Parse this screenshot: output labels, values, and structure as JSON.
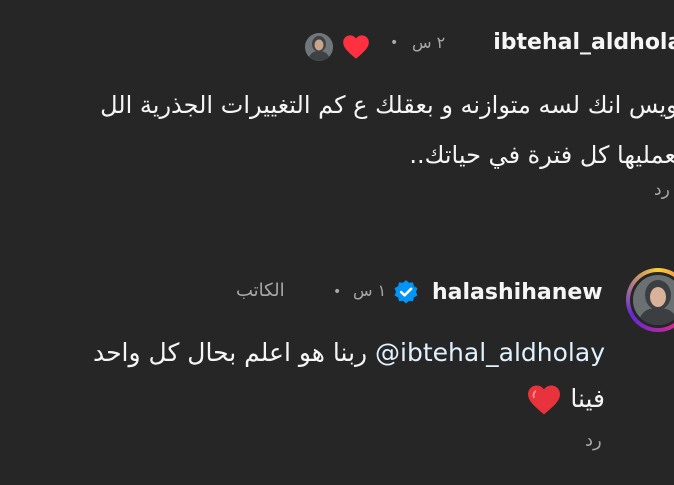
{
  "comment1": {
    "username": "ibtehal_aldholay",
    "time": "٢ س",
    "separator": "•",
    "reaction_icon": "heart-icon",
    "line1": "كويس انك لسه متوازنه و بعقلك ع كم التغييرات الجذرية الل",
    "line2": "بتعمليها كل فترة في حياتك..",
    "reply_label": "رد"
  },
  "comment2": {
    "username": "halashihanew",
    "verified_icon": "verified-badge-icon",
    "time": "١ س",
    "separator": "•",
    "author_label": "الكاتب",
    "mention": "@ibtehal_aldholay",
    "text_after_mention": "ربنا هو اعلم بحال كل واحد",
    "line2": "فينا",
    "emoji_icon": "red-heart-icon",
    "reply_label": "رد"
  },
  "colors": {
    "background": "#262626",
    "text": "#f5f5f5",
    "secondary": "#a8a8a8",
    "heart": "#ff3040",
    "verified": "#0095f6"
  }
}
